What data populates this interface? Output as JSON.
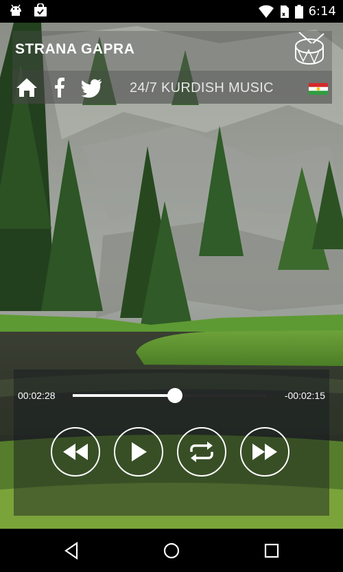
{
  "status_bar": {
    "time": "6:14",
    "icons": [
      "android-icon",
      "shopping-bag-icon",
      "wifi-icon",
      "sim-icon",
      "battery-icon"
    ]
  },
  "header": {
    "title": "STRANA GAPRA",
    "logo": "drum-icon",
    "nav_icons": [
      "home-icon",
      "facebook-icon",
      "twitter-icon"
    ],
    "tagline": "24/7 KURDISH MUSIC",
    "flag": "kurdistan-flag"
  },
  "player": {
    "elapsed": "00:02:28",
    "remaining": "-00:02:15",
    "progress": 0.53,
    "controls": [
      "rewind-icon",
      "play-icon",
      "repeat-icon",
      "fast-forward-icon"
    ]
  },
  "system_nav": {
    "buttons": [
      "back-icon",
      "home-circle-icon",
      "recents-icon"
    ]
  },
  "colors": {
    "panel": "#505050",
    "text": "#ffffff",
    "flag_red": "#d62828",
    "flag_green": "#2e9e3e",
    "flag_sun": "#f5c400"
  }
}
